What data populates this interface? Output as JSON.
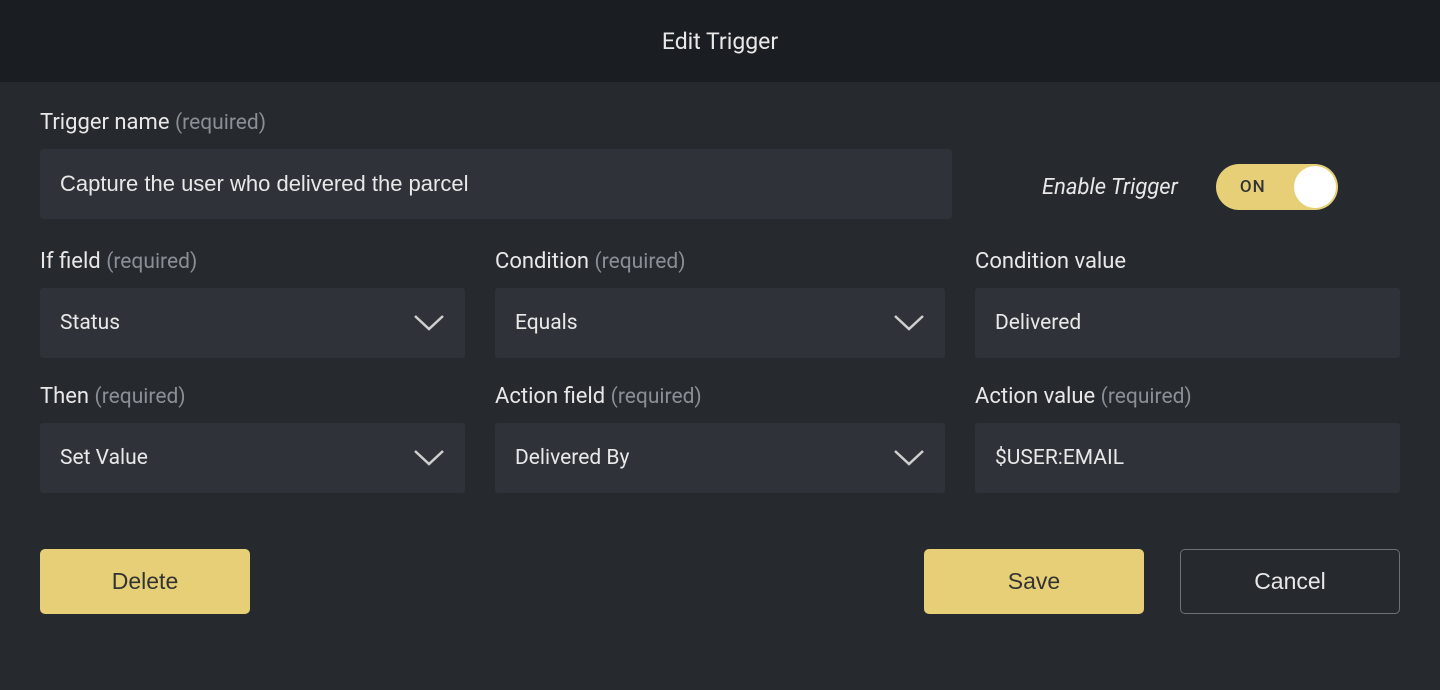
{
  "header": {
    "title": "Edit Trigger"
  },
  "triggerName": {
    "label": "Trigger name",
    "required": "(required)",
    "value": "Capture the user who delivered the parcel"
  },
  "enable": {
    "label": "Enable Trigger",
    "toggle_text": "ON",
    "state": "on"
  },
  "fields": {
    "ifField": {
      "label": "If field",
      "required": "(required)",
      "value": "Status"
    },
    "condition": {
      "label": "Condition",
      "required": "(required)",
      "value": "Equals"
    },
    "conditionValue": {
      "label": "Condition value",
      "required": "",
      "value": "Delivered"
    },
    "then": {
      "label": "Then",
      "required": "(required)",
      "value": "Set Value"
    },
    "actionField": {
      "label": "Action field",
      "required": "(required)",
      "value": "Delivered By"
    },
    "actionValue": {
      "label": "Action value",
      "required": "(required)",
      "value": "$USER:EMAIL"
    }
  },
  "buttons": {
    "delete": "Delete",
    "save": "Save",
    "cancel": "Cancel"
  },
  "colors": {
    "accent": "#e6cf76",
    "bg_header": "#1a1d21",
    "bg_body": "#26292e",
    "bg_input": "#2f3339",
    "muted": "#8a8f96"
  }
}
